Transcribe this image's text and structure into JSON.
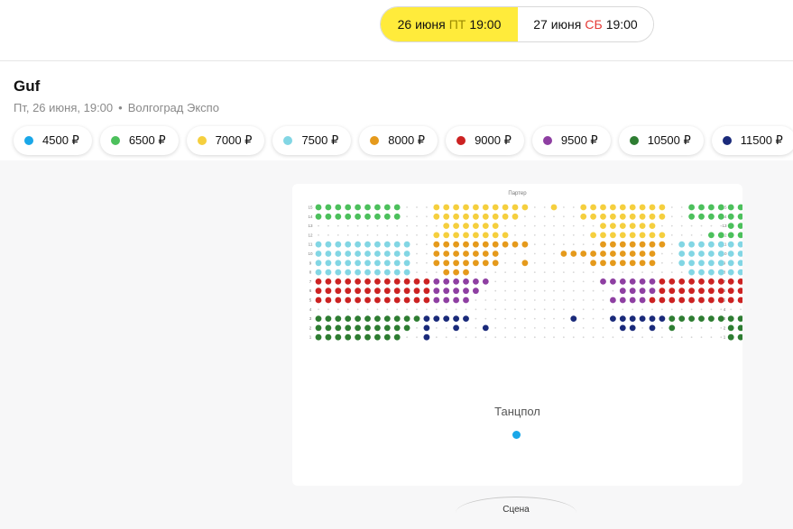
{
  "dates": [
    {
      "day": "26 июня",
      "dow": "ПТ",
      "time": "19:00",
      "active": true
    },
    {
      "day": "27 июня",
      "dow": "СБ",
      "time": "19:00",
      "active": false
    }
  ],
  "event": {
    "title": "Guf",
    "date_text": "Пт, 26 июня, 19:00",
    "separator": "•",
    "venue": "Волгоград Экспо"
  },
  "prices": [
    {
      "label": "4500 ₽",
      "color": "#1aa7e8"
    },
    {
      "label": "6500 ₽",
      "color": "#4cc05c"
    },
    {
      "label": "7000 ₽",
      "color": "#f5cf3e"
    },
    {
      "label": "7500 ₽",
      "color": "#82d6e4"
    },
    {
      "label": "8000 ₽",
      "color": "#e59a1c"
    },
    {
      "label": "9000 ₽",
      "color": "#cc2222"
    },
    {
      "label": "9500 ₽",
      "color": "#8e3fa2"
    },
    {
      "label": "10500 ₽",
      "color": "#2e7d32"
    },
    {
      "label": "11500 ₽",
      "color": "#1a2a7a"
    }
  ],
  "hall": {
    "parter_label": "Партер",
    "dance_floor_label": "Танцпол",
    "dance_floor_color": "#1aa7e8",
    "stage_label": "Сцена"
  },
  "seat_map": {
    "row_labels": [
      "15",
      "14",
      "13",
      "12",
      "11",
      "10",
      "9",
      "8",
      "7",
      "6",
      "5",
      "4",
      "3",
      "2",
      "1"
    ],
    "free_color": "#d6d6d6",
    "rows": [
      {
        "left": "GGGGGGGGG...YYYYYYYYYY..",
        "right": "Y..YYYYYYYYY..GGGGGGGGG"
      },
      {
        "left": "GGGGGGGGG...YYYYYYYYY...",
        "right": "...YYYYYYYYY..GGGGGGGGG"
      },
      {
        "left": ".............YYYYYY.....",
        "right": ".....YYYYYY.......GGGGG"
      },
      {
        "left": "............YYYYYYYY....",
        "right": "....YYYYYYYY....GGGGGGG"
      },
      {
        "left": "CCCCCCCCCC..OOOOOOOOOO..",
        "right": ".....OOOOOOO.CCCCCCCCCC"
      },
      {
        "left": "CCCCCCCCCC..OOOOOOO.....",
        "right": ".OOOOOOOOOO..CCCCCCCCCC"
      },
      {
        "left": "CCCCCCCCCC..OOOOOOO..O..",
        "right": "....OOOOOOO..CCCCCCCCCC"
      },
      {
        "left": "CCCCCCCCCC...OOO........",
        "right": "..............CCCCCCCCC"
      },
      {
        "left": "RRRRRRRRRRRRPPPPPP......",
        "right": ".....PPPPPPRRRRRRRRRRRR"
      },
      {
        "left": "RRRRRRRRRRRRPPPPP.......",
        "right": ".......PPPPRRRRRRRRRRRR"
      },
      {
        "left": "RRRRRRRRRRRRPPPP........",
        "right": "......PPPPRRRRRRRRRRRRR"
      },
      {
        "left": "........................",
        "right": "......................."
      },
      {
        "left": "DDDDDDDDDDDNNNNN........",
        "right": "..N...NNNNNNDDDDDDDDDDD"
      },
      {
        "left": "DDDDDDDDDD.N..N..N......",
        "right": ".......NN.N.D.....DDDDD"
      },
      {
        "left": "DDDDDDDDD..N............",
        "right": "..................DDDDD"
      }
    ]
  }
}
